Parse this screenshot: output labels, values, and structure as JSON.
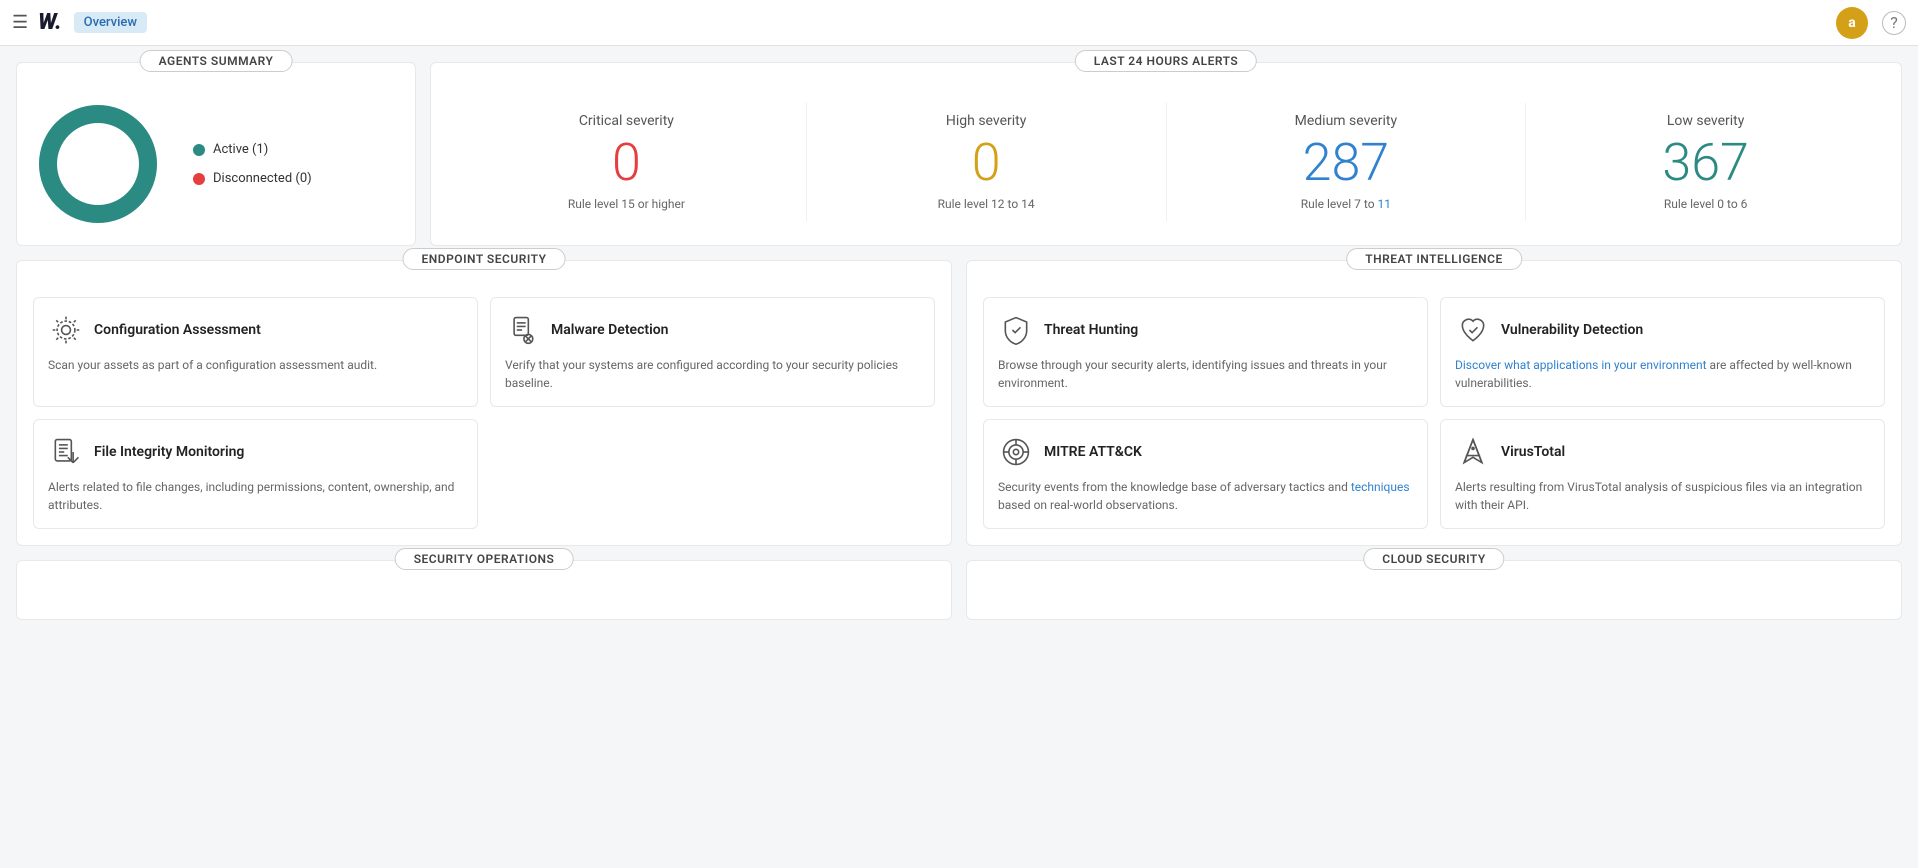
{
  "topnav": {
    "hamburger": "☰",
    "logo": "W.",
    "tab_label": "Overview",
    "avatar_letter": "a",
    "help_icon": "?"
  },
  "agents_summary": {
    "title": "AGENTS SUMMARY",
    "active_label": "Active (1)",
    "disconnected_label": "Disconnected (0)",
    "active_color": "#2b8a82",
    "disconnected_color": "#e53e3e",
    "donut_color": "#2b8a82",
    "donut_bg": "#e8e8e8"
  },
  "alerts": {
    "title": "LAST 24 HOURS ALERTS",
    "columns": [
      {
        "label": "Critical severity",
        "number": "0",
        "color": "red",
        "desc": "Rule level 15 or higher"
      },
      {
        "label": "High severity",
        "number": "0",
        "color": "yellow",
        "desc": "Rule level 12 to 14"
      },
      {
        "label": "Medium severity",
        "number": "287",
        "color": "blue",
        "desc_prefix": "Rule level 7 to ",
        "desc_link": "11",
        "desc": "Rule level 7 to 11"
      },
      {
        "label": "Low severity",
        "number": "367",
        "color": "teal",
        "desc": "Rule level 0 to 6"
      }
    ]
  },
  "endpoint_security": {
    "title": "ENDPOINT SECURITY",
    "cards": [
      {
        "title": "Configuration Assessment",
        "desc": "Scan your assets as part of a configuration assessment audit.",
        "icon": "gear"
      },
      {
        "title": "Malware Detection",
        "desc": "Verify that your systems are configured according to your security policies baseline.",
        "icon": "malware"
      },
      {
        "title": "File Integrity Monitoring",
        "desc": "Alerts related to file changes, including permissions, content, ownership, and attributes.",
        "icon": "file"
      }
    ]
  },
  "threat_intelligence": {
    "title": "THREAT INTELLIGENCE",
    "cards": [
      {
        "title": "Threat Hunting",
        "desc": "Browse through your security alerts, identifying issues and threats in your environment.",
        "icon": "shield"
      },
      {
        "title": "Vulnerability Detection",
        "desc": "Discover what applications in your environment are affected by well-known vulnerabilities.",
        "icon": "heart-check",
        "desc_has_link": false
      },
      {
        "title": "MITRE ATT&CK",
        "desc_prefix": "Security events from the knowledge base of adversary tactics and ",
        "desc_link": "techniques",
        "desc_suffix": " based on real-world observations.",
        "desc": "Security events from the knowledge base of adversary tactics and techniques based on real-world observations.",
        "icon": "target"
      },
      {
        "title": "VirusTotal",
        "desc": "Alerts resulting from VirusTotal analysis of suspicious files via an integration with their API.",
        "icon": "virus"
      }
    ]
  },
  "security_operations": {
    "title": "SECURITY OPERATIONS"
  },
  "cloud_security": {
    "title": "CLOUD SECURITY"
  }
}
